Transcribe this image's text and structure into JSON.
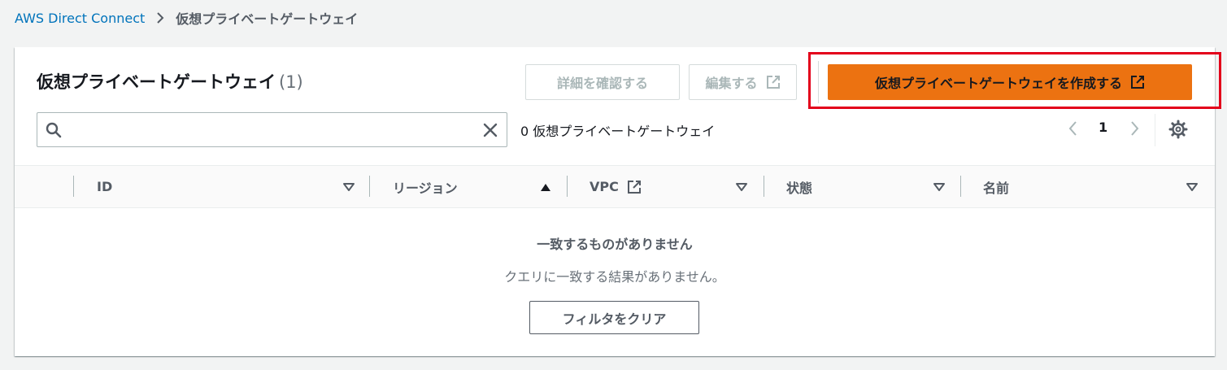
{
  "breadcrumb": {
    "root": "AWS Direct Connect",
    "current": "仮想プライベートゲートウェイ"
  },
  "panel": {
    "title": "仮想プライベートゲートウェイ",
    "count": "(1)"
  },
  "actions": {
    "details_label": "詳細を確認する",
    "edit_label": "編集する",
    "create_label": "仮想プライベートゲートウェイを作成する"
  },
  "search": {
    "value": "",
    "placeholder": ""
  },
  "match_count": "0 仮想プライベートゲートウェイ",
  "pagination": {
    "current_page": "1"
  },
  "table": {
    "columns": [
      "ID",
      "リージョン",
      "VPC",
      "状態",
      "名前"
    ]
  },
  "empty_state": {
    "title": "一致するものがありません",
    "subtitle": "クエリに一致する結果がありません。",
    "clear_button": "フィルタをクリア"
  },
  "colors": {
    "primary_button": "#ec7211",
    "link": "#0073bb",
    "highlight_box": "#e3001b"
  },
  "icons": [
    "chevron-right-icon",
    "external-link-icon",
    "search-icon",
    "clear-icon",
    "chevron-left-icon",
    "settings-gear-icon",
    "sort-caret-down-icon",
    "sort-caret-up-icon"
  ]
}
